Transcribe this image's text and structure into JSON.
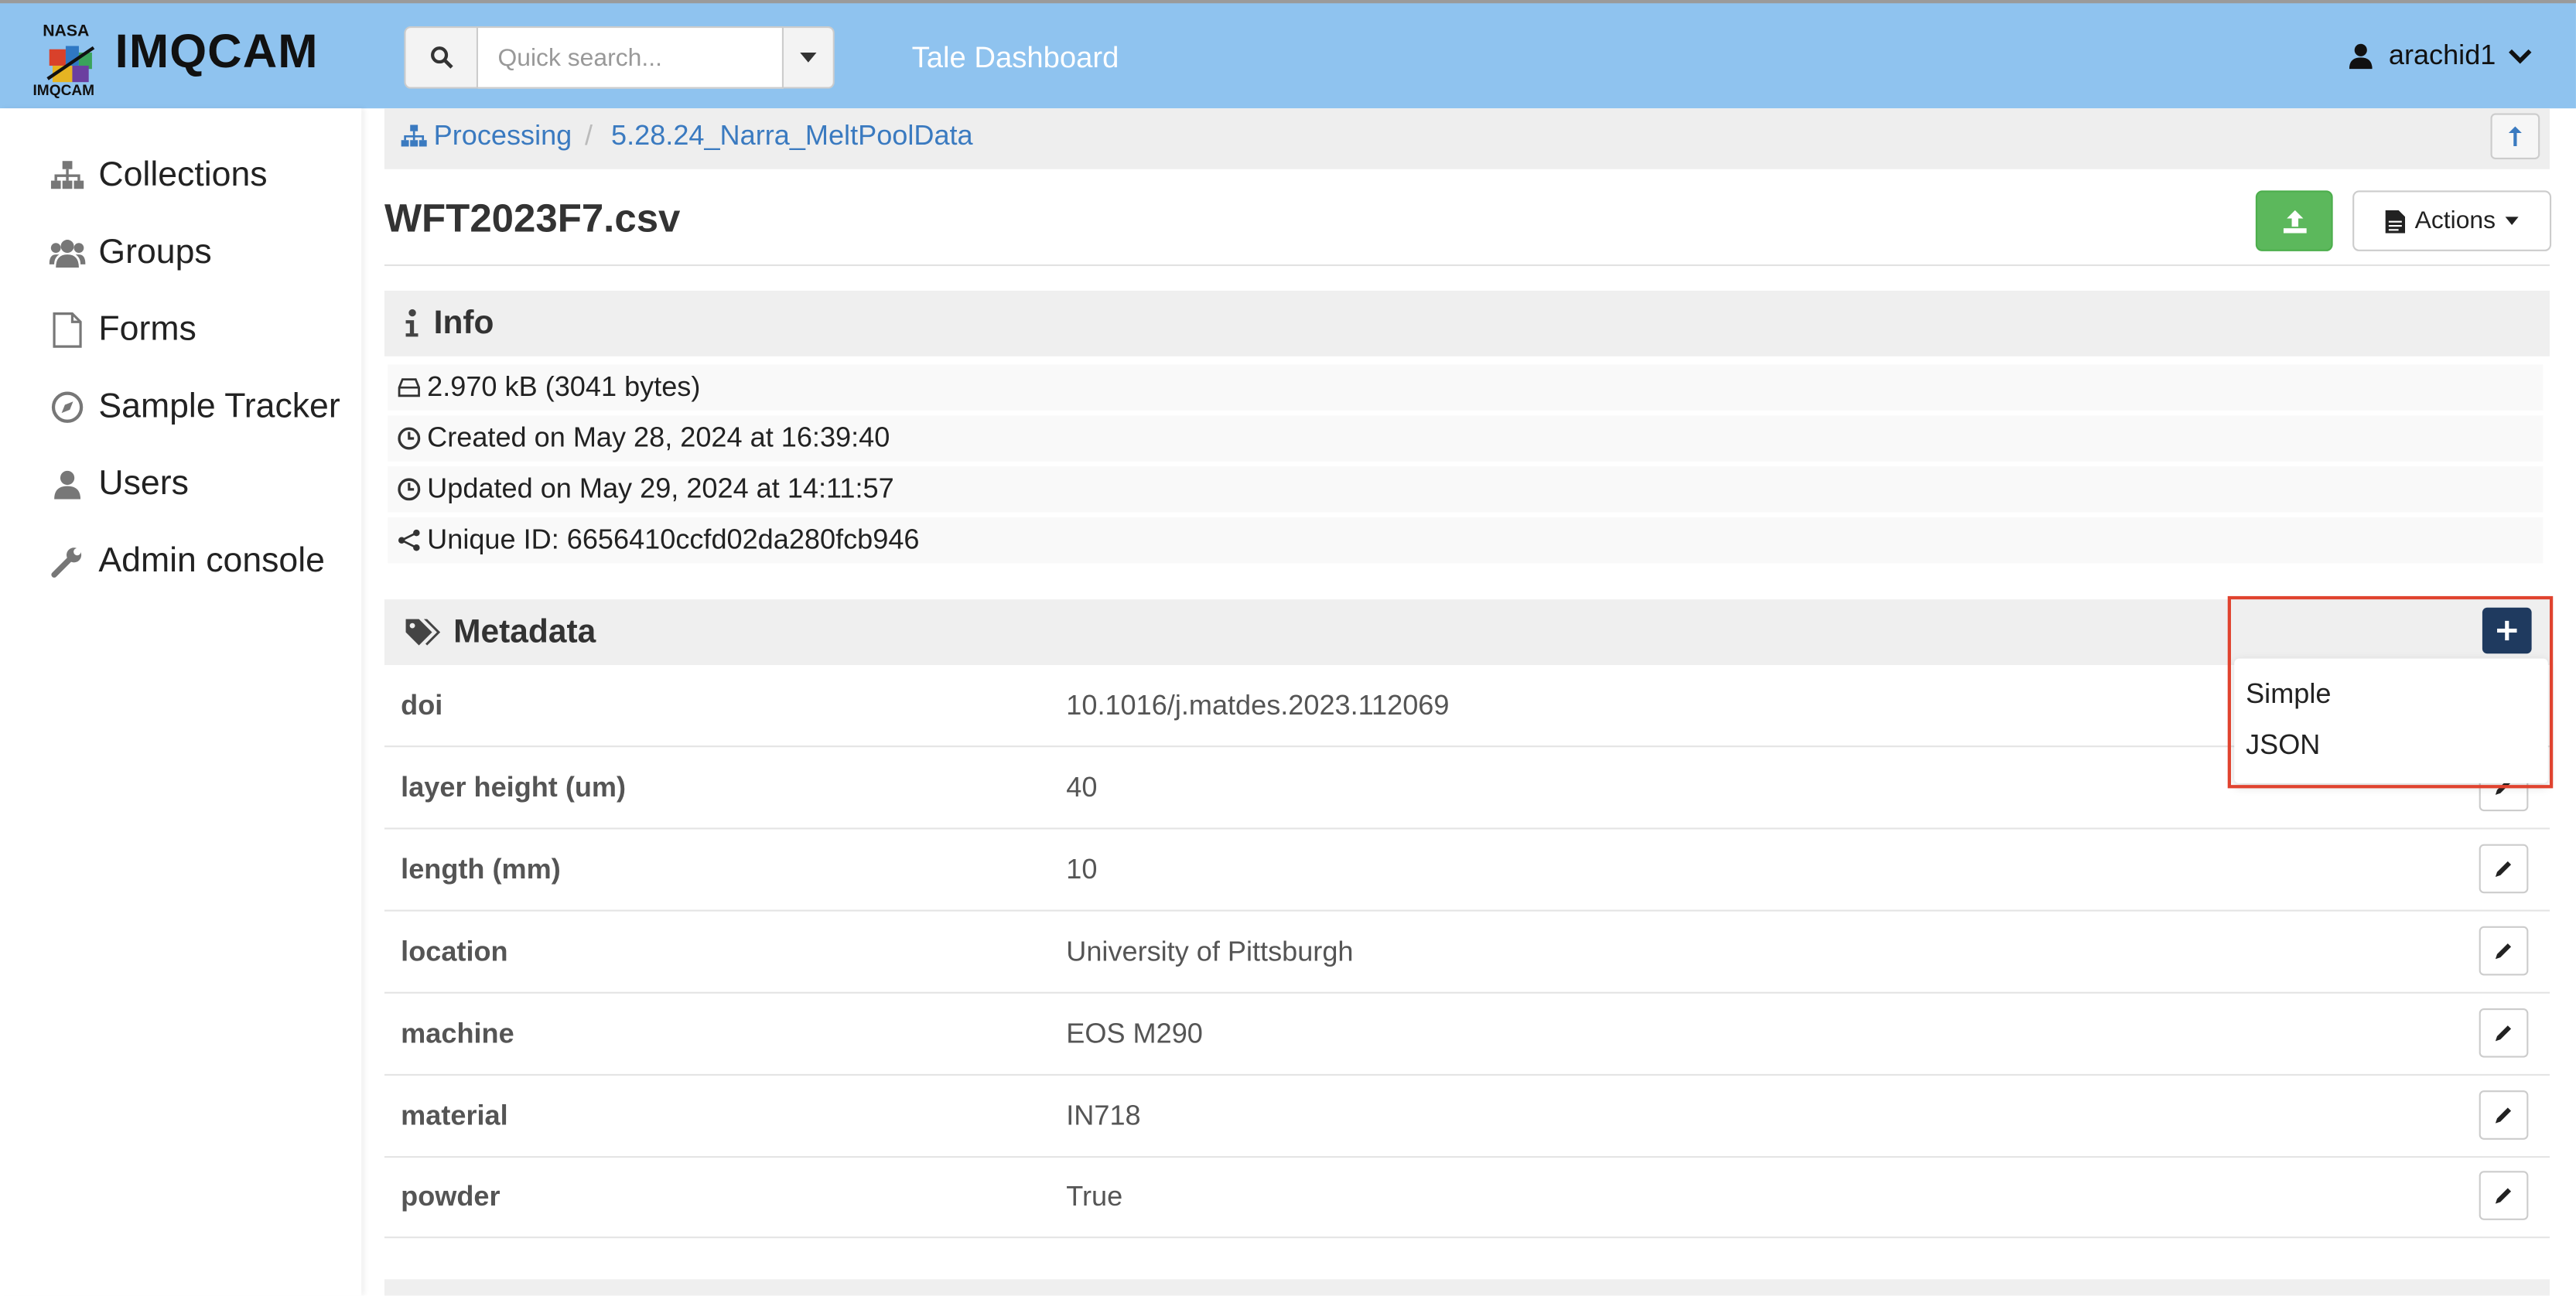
{
  "header": {
    "logo_top": "NASA",
    "logo_bottom": "IMQCAM",
    "app_title": "IMQCAM",
    "search_placeholder": "Quick search...",
    "nav_link": "Tale Dashboard",
    "username": "arachid1",
    "header_color": "#8fc3ef"
  },
  "sidebar": {
    "items": [
      {
        "label": "Collections",
        "icon": "sitemap-icon"
      },
      {
        "label": "Groups",
        "icon": "users-group-icon"
      },
      {
        "label": "Forms",
        "icon": "file-icon"
      },
      {
        "label": "Sample Tracker",
        "icon": "compass-icon"
      },
      {
        "label": "Users",
        "icon": "user-icon"
      },
      {
        "label": "Admin console",
        "icon": "wrench-icon"
      }
    ]
  },
  "breadcrumb": {
    "root": "Processing",
    "separator": "/",
    "current": "5.28.24_Narra_MeltPoolData"
  },
  "file": {
    "title": "WFT2023F7.csv",
    "actions_label": "Actions"
  },
  "info": {
    "heading": "Info",
    "size": "2.970 kB (3041 bytes)",
    "created": "Created on May 28, 2024 at 16:39:40",
    "updated": "Updated on May 29, 2024 at 14:11:57",
    "unique_id": "Unique ID: 6656410ccfd02da280fcb946"
  },
  "metadata": {
    "heading": "Metadata",
    "rows": [
      {
        "key": "doi",
        "value": "10.1016/j.matdes.2023.112069"
      },
      {
        "key": "layer height (um)",
        "value": "40"
      },
      {
        "key": "length (mm)",
        "value": "10"
      },
      {
        "key": "location",
        "value": "University of Pittsburgh"
      },
      {
        "key": "machine",
        "value": "EOS M290"
      },
      {
        "key": "material",
        "value": "IN718"
      },
      {
        "key": "powder",
        "value": "True"
      }
    ],
    "add_menu": [
      "Simple",
      "JSON"
    ]
  },
  "colors": {
    "link": "#3a7ac0",
    "upload_green": "#5cb85c",
    "add_button_navy": "#1f3a5f",
    "highlight_red": "#e0432f"
  }
}
